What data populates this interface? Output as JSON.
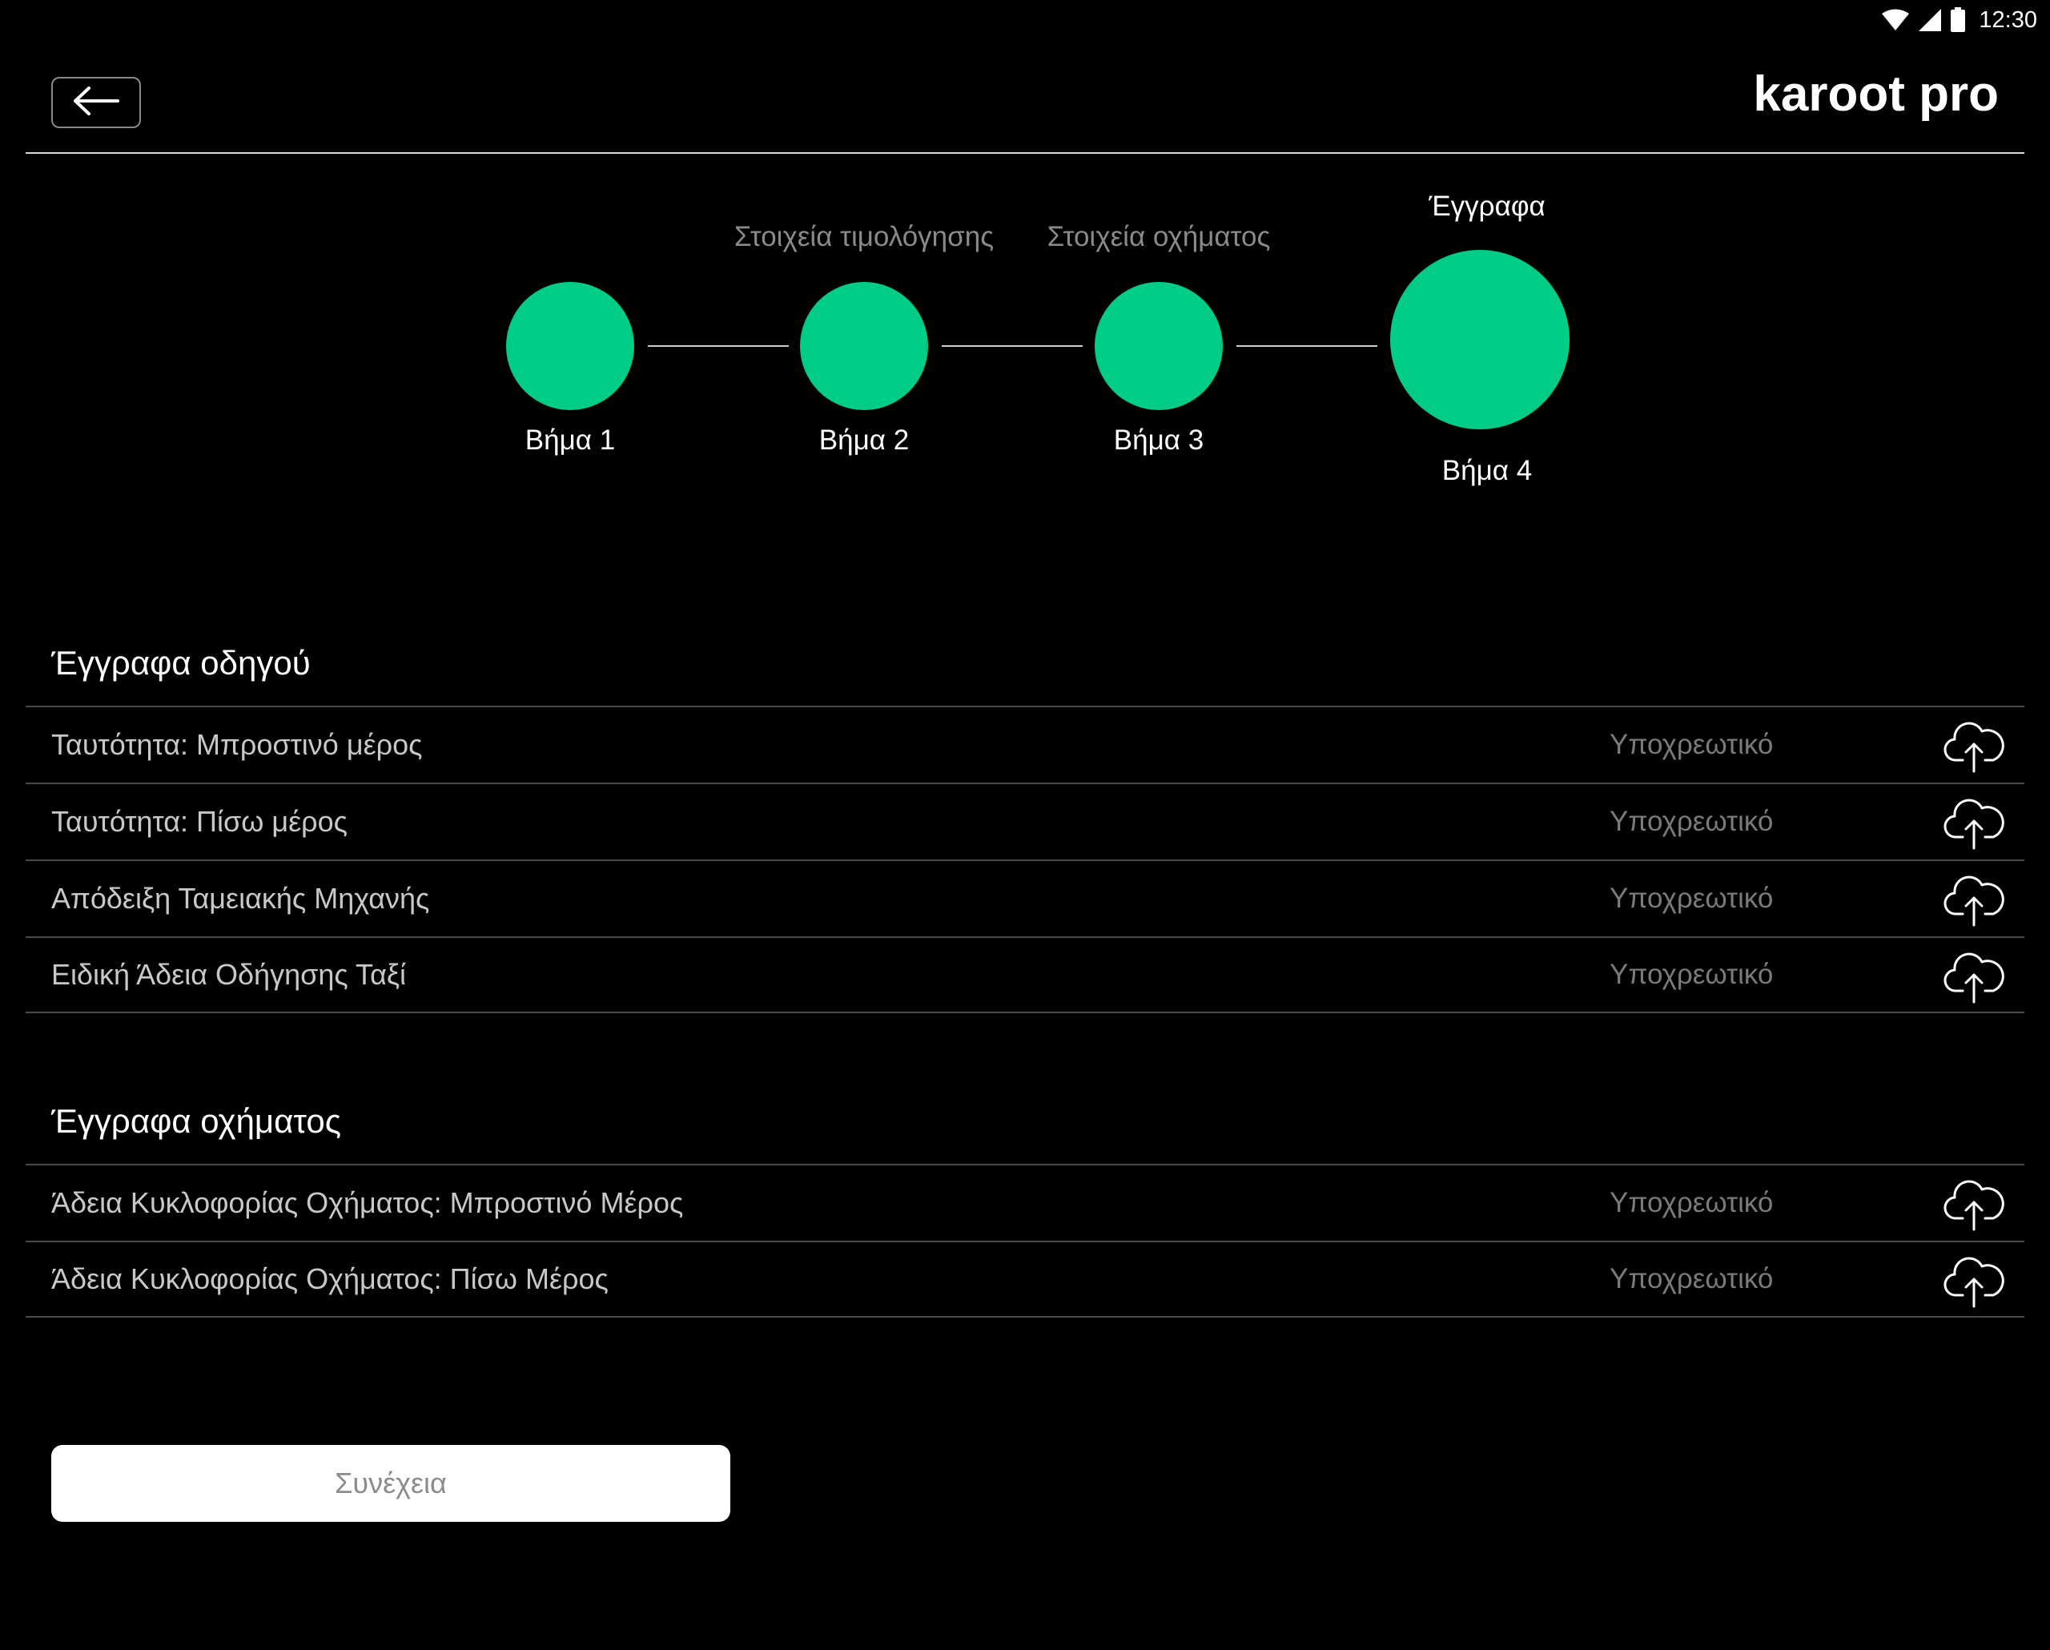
{
  "status_bar": {
    "time": "12:30",
    "icons": [
      "wifi-icon",
      "cellular-signal-icon",
      "battery-icon"
    ]
  },
  "header": {
    "back_icon": "arrow-left-icon",
    "brand": "karoot pro"
  },
  "stepper": {
    "accent_color": "#00cd85",
    "steps": [
      {
        "label": "Βήμα 1",
        "title": ""
      },
      {
        "label": "Βήμα 2",
        "title": "Στοιχεία τιμολόγησης"
      },
      {
        "label": "Βήμα 3",
        "title": "Στοιχεία οχήματος"
      },
      {
        "label": "Βήμα 4",
        "title": "Έγγραφα",
        "active": true
      }
    ]
  },
  "driver_documents": {
    "title": "Έγγραφα οδηγού",
    "items": [
      {
        "name": "Ταυτότητα: Μπροστινό μέρος",
        "status": "Υποχρεωτικό",
        "icon": "cloud-upload-icon"
      },
      {
        "name": "Ταυτότητα: Πίσω μέρος",
        "status": "Υποχρεωτικό",
        "icon": "cloud-upload-icon"
      },
      {
        "name": "Απόδειξη Ταμειακής Μηχανής",
        "status": "Υποχρεωτικό",
        "icon": "cloud-upload-icon"
      },
      {
        "name": "Ειδική Άδεια Οδήγησης Ταξί",
        "status": "Υποχρεωτικό",
        "icon": "cloud-upload-icon"
      }
    ]
  },
  "vehicle_documents": {
    "title": "Έγγραφα οχήματος",
    "items": [
      {
        "name": "Άδεια Κυκλοφορίας Οχήματος: Μπροστινό Μέρος",
        "status": "Υποχρεωτικό",
        "icon": "cloud-upload-icon"
      },
      {
        "name": "Άδεια Κυκλοφορίας Οχήματος: Πίσω Μέρος",
        "status": "Υποχρεωτικό",
        "icon": "cloud-upload-icon"
      }
    ]
  },
  "continue_button": {
    "label": "Συνέχεια"
  }
}
